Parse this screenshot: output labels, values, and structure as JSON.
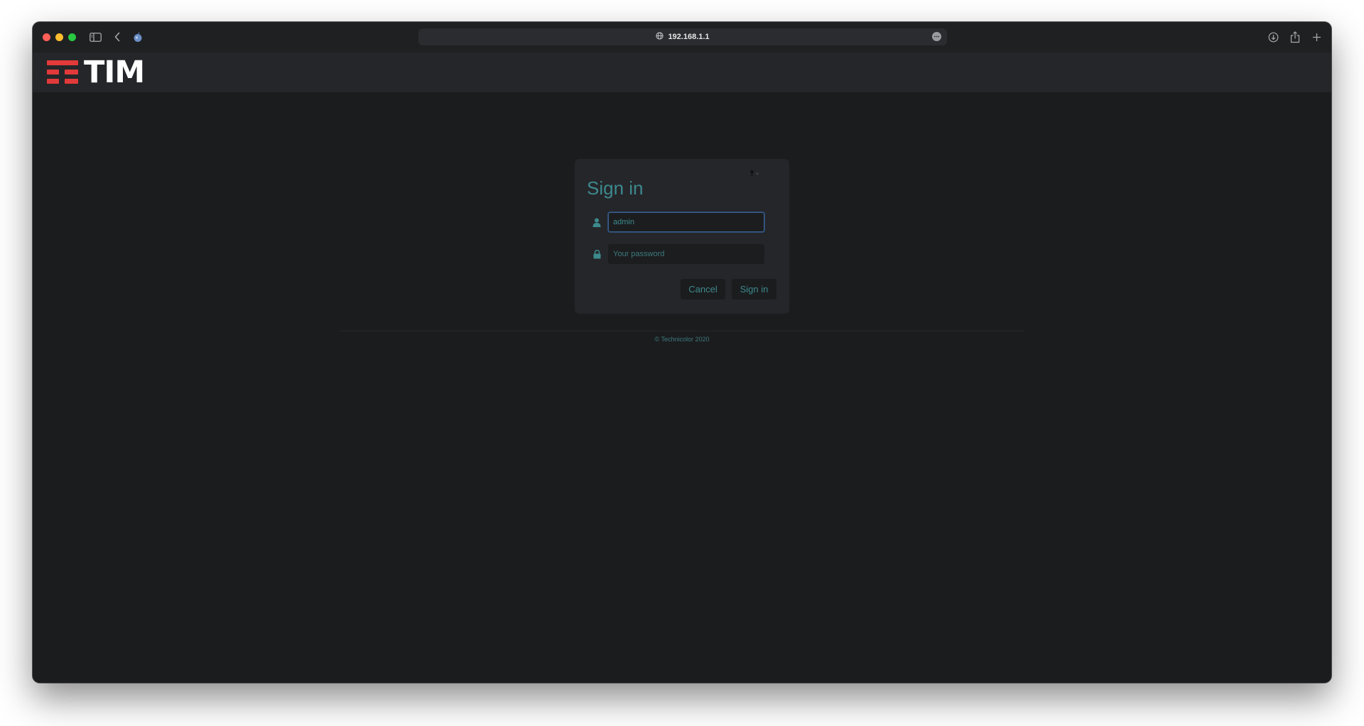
{
  "browser": {
    "url": "192.168.1.1",
    "traffic_lights": {
      "close": "#fe5f57",
      "minimize": "#febc2e",
      "zoom": "#28c840"
    },
    "icons": [
      "sidebar-icon",
      "back-icon",
      "shield-icon",
      "globe-icon",
      "more-icon",
      "download-icon",
      "share-icon",
      "new-tab-icon"
    ]
  },
  "header": {
    "logo_text": "TIM",
    "logo_color": "#e23a3a"
  },
  "signin": {
    "title": "Sign in",
    "username_value": "admin",
    "password_placeholder": "Your password",
    "cancel_label": "Cancel",
    "submit_label": "Sign in",
    "accent_color": "#3d8a8d"
  },
  "footer": {
    "copyright": "© Technicolor 2020"
  }
}
